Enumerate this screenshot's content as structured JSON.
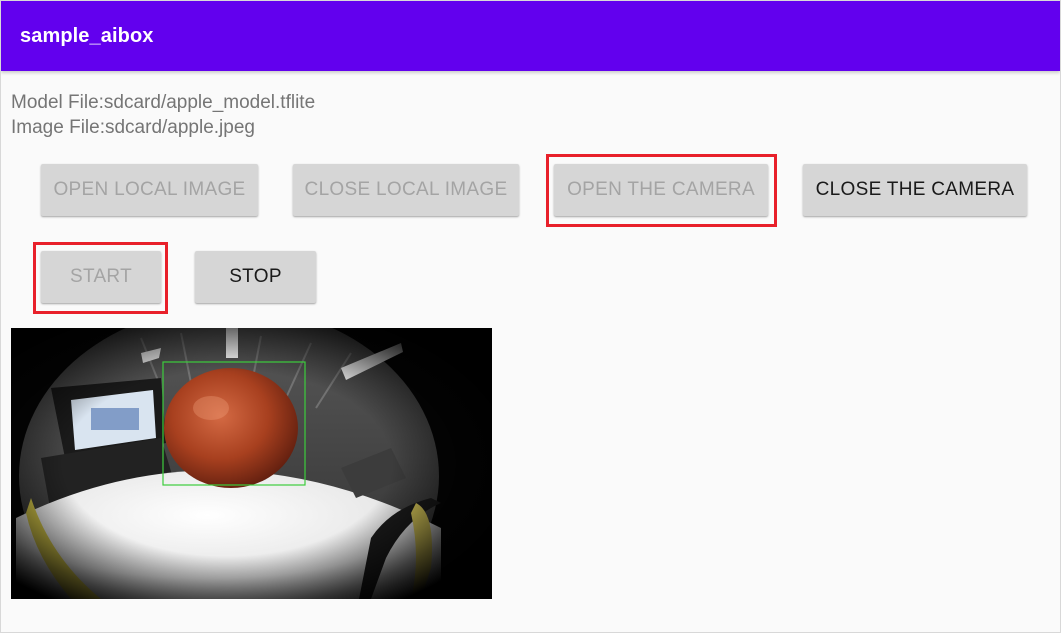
{
  "app": {
    "title": "sample_aibox",
    "accent_color": "#6200ee"
  },
  "info": {
    "model_file": "Model File:sdcard/apple_model.tflite",
    "image_file": "Image File:sdcard/apple.jpeg"
  },
  "buttons": {
    "open_local_image": {
      "label": "OPEN LOCAL IMAGE",
      "enabled": false
    },
    "close_local_image": {
      "label": "CLOSE LOCAL IMAGE",
      "enabled": false
    },
    "open_camera": {
      "label": "OPEN THE CAMERA",
      "enabled": false,
      "highlighted": true
    },
    "close_camera": {
      "label": "CLOSE THE CAMERA",
      "enabled": true
    },
    "start": {
      "label": "START",
      "enabled": false,
      "highlighted": true
    },
    "stop": {
      "label": "STOP",
      "enabled": true
    }
  },
  "highlight_color": "#e8202a",
  "preview": {
    "detection_box_color": "#3ccd3c",
    "detected_object": "apple"
  }
}
